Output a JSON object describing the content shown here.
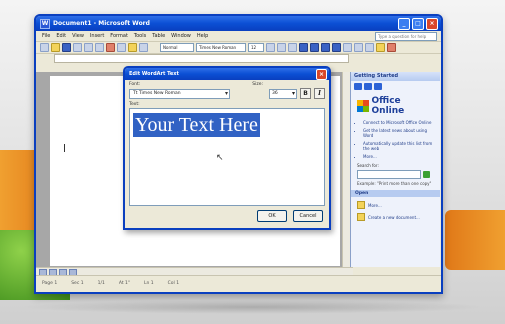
{
  "window": {
    "title": "Document1 - Microsoft Word"
  },
  "menu": {
    "items": [
      "File",
      "Edit",
      "View",
      "Insert",
      "Format",
      "Tools",
      "Table",
      "Window",
      "Help"
    ],
    "help_placeholder": "Type a question for help"
  },
  "toolbar": {
    "style": "Normal",
    "font": "Times New Roman",
    "size": "12"
  },
  "dialog": {
    "title": "Edit WordArt Text",
    "font_label": "Font:",
    "font_value": "Tt Times New Roman",
    "size_label": "Size:",
    "size_value": "36",
    "bold_label": "B",
    "italic_label": "I",
    "text_label": "Text:",
    "text_value": "Your Text Here",
    "ok_label": "OK",
    "cancel_label": "Cancel"
  },
  "taskpane": {
    "title": "Getting Started",
    "brand": "Office Online",
    "links": [
      "Connect to Microsoft Office Online",
      "Get the latest news about using Word",
      "Automatically update this list from the web"
    ],
    "more": "More...",
    "search_label": "Search for:",
    "example": "Example: \"Print more than one copy\"",
    "open_section": "Open",
    "open_more": "More...",
    "create_new": "Create a new document..."
  },
  "statusbar": {
    "items": [
      "Page 1",
      "Sec 1",
      "1/1",
      "At 1\"",
      "Ln 1",
      "Col 1"
    ]
  }
}
